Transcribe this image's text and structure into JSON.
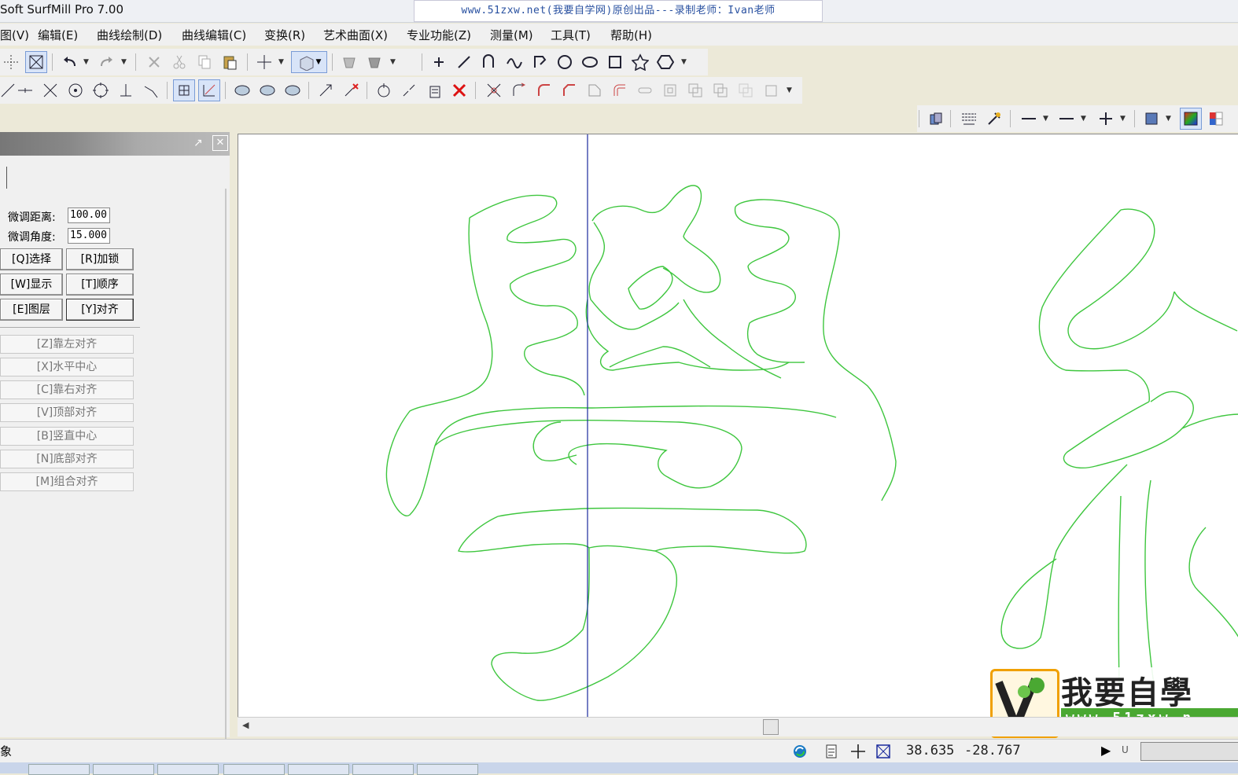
{
  "window": {
    "title": "Soft SurfMill Pro 7.00",
    "banner": "www.51zxw.net(我要自学网)原创出品---录制老师：Ivan老师"
  },
  "menu": [
    "图(V)",
    "编辑(E)",
    "曲线绘制(D)",
    "曲线编辑(C)",
    "变换(R)",
    "艺术曲面(X)",
    "专业功能(Z)",
    "测量(M)",
    "工具(T)",
    "帮助(H)"
  ],
  "panel": {
    "fine_distance_label": "微调距离:",
    "fine_distance_value": "100.00",
    "fine_angle_label": "微调角度:",
    "fine_angle_value": "15.000",
    "buttons": [
      "[Q]选择",
      "[R]加锁",
      "[W]显示",
      "[T]顺序",
      "[E]图层",
      "[Y]对齐"
    ],
    "align_buttons": [
      "[Z]靠左对齐",
      "[X]水平中心",
      "[C]靠右对齐",
      "[V]顶部对齐",
      "[B]竖直中心",
      "[N]底部对齐",
      "[M]组合对齐"
    ]
  },
  "canvas": {
    "logo_text": "我要自學",
    "logo_url": "www.51zxw.n"
  },
  "status": {
    "left_text": "象",
    "coord_x": "38.635",
    "coord_y": "-28.767",
    "unit": "U"
  },
  "colors": {
    "curve": "#3ec63e",
    "axis": "#1a2a9c",
    "logo_green": "#4aa832"
  }
}
